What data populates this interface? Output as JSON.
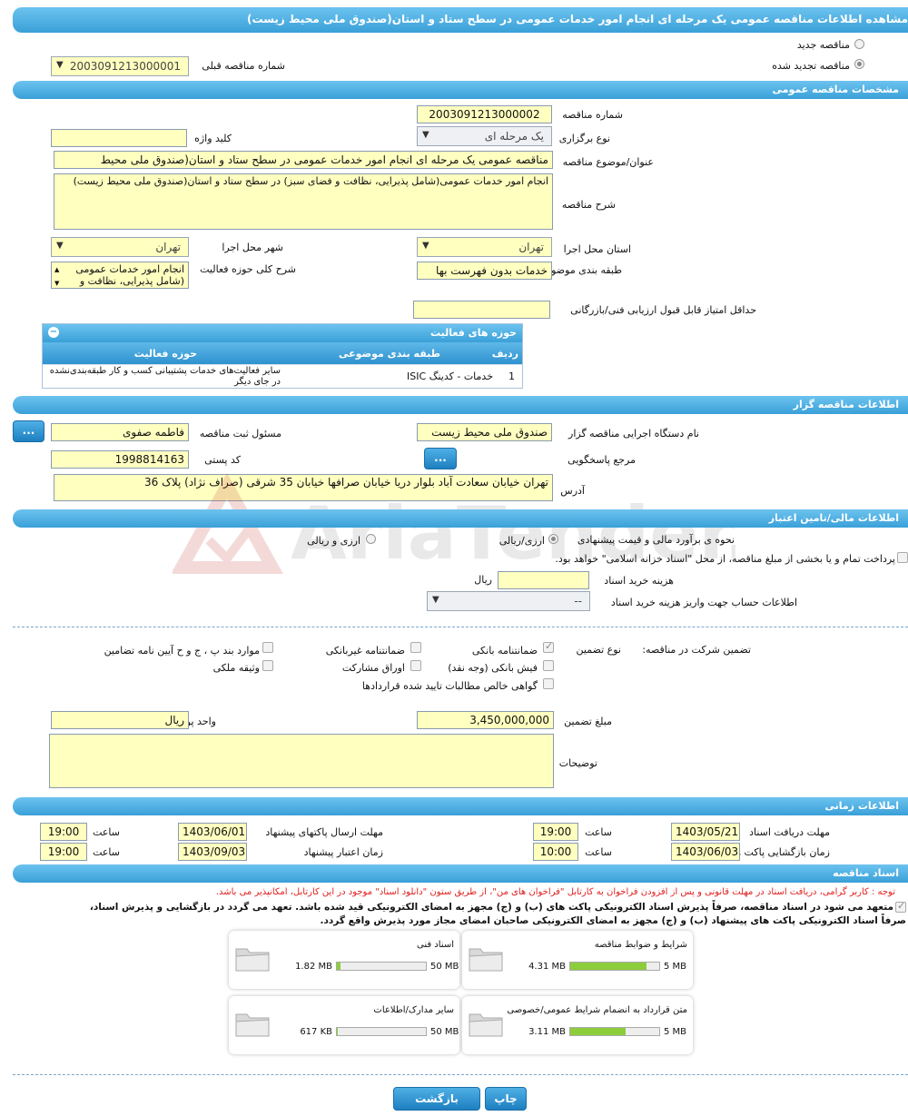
{
  "page_title": "مشاهده اطلاعات مناقصه عمومی یک مرحله ای انجام امور خدمات عمومی در سطح ستاد و استان(صندوق ملی محیط زیست)",
  "tender_type": {
    "new_label": "مناقصه جدید",
    "renewed_label": "مناقصه تجدید شده",
    "prev_number_label": "شماره مناقصه قبلی",
    "prev_number_value": "2003091213000001"
  },
  "general": {
    "section_title": "مشخصات مناقصه عمومی",
    "number_label": "شماره مناقصه",
    "number_value": "2003091213000002",
    "holding_label": "نوع برگزاری",
    "holding_value": "یک مرحله ای",
    "keyword_label": "کلید واژه",
    "keyword_value": "",
    "title_label": "عنوان/موضوع مناقصه",
    "title_value": "مناقصه عمومی یک مرحله ای انجام امور خدمات عمومی در سطح ستاد و استان(صندوق ملی محیط",
    "desc_label": "شرح مناقصه",
    "desc_value": "انجام امور خدمات عمومی(شامل پذیرایی، نظافت و فضای سبز) در سطح ستاد و استان(صندوق ملی محیط زیست)",
    "province_label": "استان محل اجرا",
    "province_value": "تهران",
    "city_label": "شهر محل اجرا",
    "city_value": "تهران",
    "category_label": "طبقه بندی موضوعی",
    "category_value": "خدمات بدون فهرست بها",
    "scope_label": "شرح کلی حوزه فعالیت",
    "scope_value": "انجام امور خدمات عمومی (شامل پذیرایی، نظافت و",
    "min_score_label": "حداقل امتیاز قابل قبول ارزیابی فنی/بازرگانی",
    "min_score_value": ""
  },
  "activity_table": {
    "title": "حوزه های فعالیت",
    "headers": [
      "ردیف",
      "طبقه بندی موضوعی",
      "حوزه فعالیت"
    ],
    "rows": [
      [
        "1",
        "خدمات - کدینگ ISIC",
        "سایر فعالیت‌های خدمات پشتیبانی کسب و کار طبقه‌بندی‌نشده در جای دیگر"
      ]
    ]
  },
  "organizer": {
    "section_title": "اطلاعات مناقصه گزار",
    "agency_label": "نام دستگاه اجرایی مناقصه گزار",
    "agency_value": "صندوق ملی محیط زیست",
    "responsible_label": "مسئول ثبت مناقصه",
    "responsible_value": "فاطمه  صفوی",
    "more_button": "...",
    "reference_label": "مرجع پاسخگویی",
    "postal_label": "کد پستی",
    "postal_value": "1998814163",
    "address_label": "آدرس",
    "address_value": "تهران خیابان سعادت آباد بلوار دریا خیابان صرافها خیابان 35 شرقی (صراف نژاد) پلاک 36"
  },
  "financial": {
    "section_title": "اطلاعات مالی/تامین اعتبار",
    "estimate_label": "نحوه ی برآورد مالی و قیمت پیشنهادی",
    "opt_currency": "ارزی/ریالی",
    "opt_rial": "ارزی و ریالی",
    "treasury_text": "پرداخت تمام و یا بخشی از مبلغ مناقصه، از محل \"اسناد خزانه اسلامی\" خواهد بود.",
    "doc_cost_label": "هزینه خرید اسناد",
    "doc_cost_value": "",
    "doc_cost_unit": "ریال",
    "account_label": "اطلاعات حساب جهت واریز هزینه خرید اسناد",
    "account_value": "--"
  },
  "guarantee": {
    "participation_label": "تضمین شرکت در مناقصه:",
    "type_label": "نوع تضمین",
    "opts": {
      "bank_guarantee": "ضمانتنامه بانکی",
      "non_bank": "ضمانتنامه غیربانکی",
      "cases": "موارد بند پ ، ج و ح آیین نامه تضامین",
      "bank_check": "فیش بانکی (وجه نقد)",
      "bonds": "اوراق مشارکت",
      "property": "وثیقه ملکی",
      "claims": "گواهی خالص مطالبات تایید شده قراردادها"
    },
    "amount_label": "مبلغ تضمین",
    "amount_value": "3,450,000,000",
    "currency_label": "واحد پول",
    "currency_value": "ریال",
    "notes_label": "توضیحات",
    "notes_value": ""
  },
  "timing": {
    "section_title": "اطلاعات زمانی",
    "receive_label": "مهلت دریافت اسناد",
    "receive_date": "1403/05/21",
    "receive_time": "19:00",
    "send_label": "مهلت ارسال پاکتهای پیشنهاد",
    "send_date": "1403/06/01",
    "send_time": "19:00",
    "open_label": "زمان بازگشایی پاکت ها",
    "open_date": "1403/06/03",
    "open_time": "10:00",
    "validity_label": "زمان اعتبار پیشنهاد",
    "validity_date": "1403/09/03",
    "validity_time": "19:00",
    "time_label": "ساعت"
  },
  "documents": {
    "section_title": "اسناد مناقصه",
    "notice": "توجه : کاربر گرامی، دریافت اسناد در مهلت قانونی و پس از افزودن فراخوان به کارتابل \"فراخوان های من\"، از طریق ستون \"دانلود اسناد\" موجود در این کارتابل، امکانپذیر می باشد.",
    "commit_line1": "متعهد می شود در اسناد مناقصه، صرفاً پذیرش اسناد الکترونیکی پاکت های (ب) و (ج) مجهز به امضای الکترونیکی قید شده باشد. تعهد می گردد در بازگشایی و پذیرش اسناد،",
    "commit_line2": "صرفاً اسناد الکترونیکی پاکت های پیشنهاد (ب) و (ج) مجهز به امضای الکترونیکی صاحبان امضای مجاز مورد پذیرش واقع گردد.",
    "cards": [
      {
        "name": "شرایط و ضوابط مناقصه",
        "used": "4.31 MB",
        "max": "5 MB",
        "fraction": 0.86
      },
      {
        "name": "اسناد فنی",
        "used": "1.82 MB",
        "max": "50 MB",
        "fraction": 0.04
      },
      {
        "name": "متن قرارداد به انضمام شرایط عمومی/خصوصی",
        "used": "3.11 MB",
        "max": "5 MB",
        "fraction": 0.62
      },
      {
        "name": "سایر مدارک/اطلاعات",
        "used": "617 KB",
        "max": "50 MB",
        "fraction": 0.012
      }
    ]
  },
  "footer": {
    "print_label": "چاپ",
    "back_label": "بازگشت"
  },
  "watermark_text": "AriaTender.neT"
}
